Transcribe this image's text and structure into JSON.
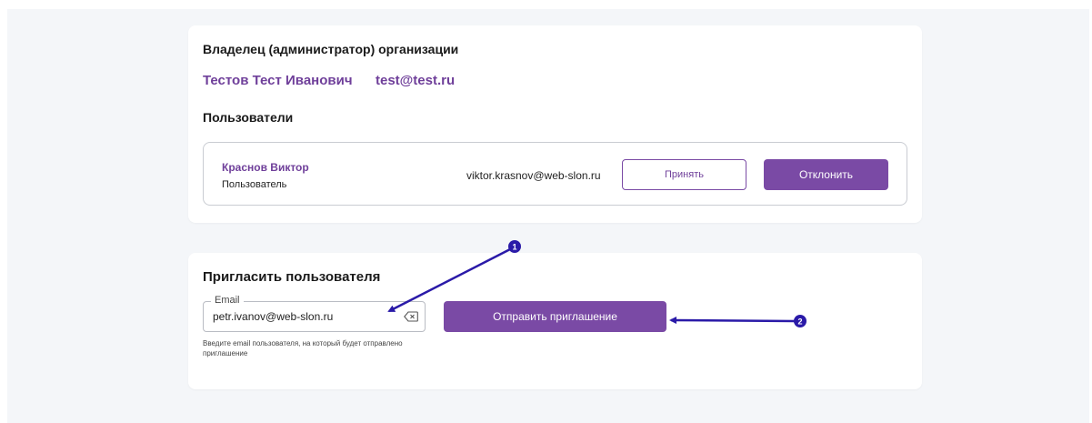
{
  "colors": {
    "accent": "#7a4aa5",
    "accent_text": "#6f3f9a",
    "annotation": "#2a1aa8",
    "page_bg": "#f4f6f9"
  },
  "owner_section": {
    "heading": "Владелец (администратор) организации",
    "name": "Тестов Тест Иванович",
    "email": "test@test.ru"
  },
  "users_section": {
    "heading": "Пользователи",
    "users": [
      {
        "name": "Краснов Виктор",
        "role": "Пользователь",
        "email": "viktor.krasnov@web-slon.ru",
        "accept_label": "Принять",
        "decline_label": "Отклонить"
      }
    ]
  },
  "invite_section": {
    "heading": "Пригласить пользователя",
    "email_label": "Email",
    "email_value": "petr.ivanov@web-slon.ru",
    "helper_text": "Введите email пользователя, на который будет отправлено приглашение",
    "send_label": "Отправить приглашение",
    "clear_icon": "backspace-clear-icon"
  },
  "annotations": [
    {
      "number": "1"
    },
    {
      "number": "2"
    }
  ]
}
